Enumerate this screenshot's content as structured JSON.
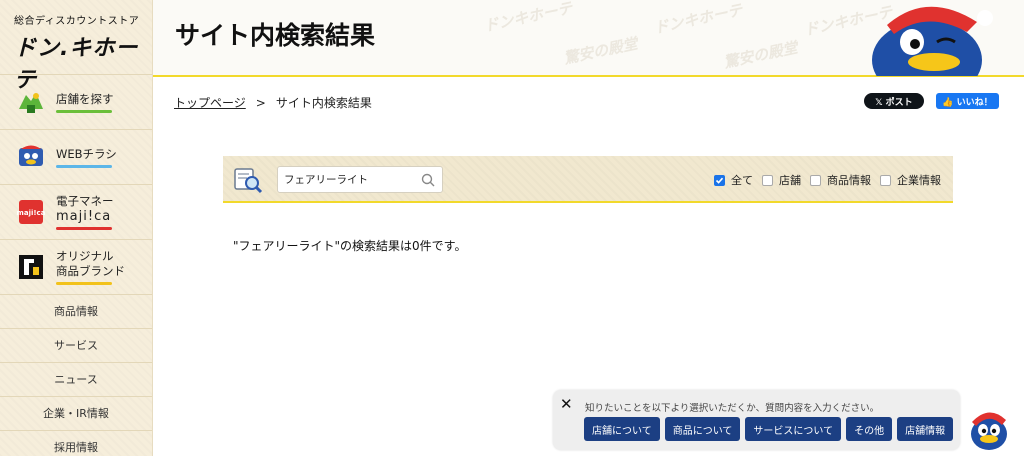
{
  "brand": {
    "tagline": "総合ディスカウントストア",
    "name": "ドン.キホーテ"
  },
  "sidebar": {
    "primary": [
      {
        "label": "店舗を探す",
        "accent": "#6bbf3a",
        "icon": "store-map-icon"
      },
      {
        "label": "WEBチラシ",
        "accent": "#5cb6e8",
        "icon": "mascot-flyer-icon"
      },
      {
        "label_line1": "電子マネー",
        "label_line2": "maji!ca",
        "accent": "#e0322f",
        "icon": "majica-card-icon"
      },
      {
        "label_line1": "オリジナル",
        "label_line2": "商品ブランド",
        "accent": "#f2c21b",
        "icon": "brand-logo-icon"
      }
    ],
    "secondary": [
      {
        "label": "商品情報"
      },
      {
        "label": "サービス"
      },
      {
        "label": "ニュース"
      },
      {
        "label": "企業・IR情報"
      },
      {
        "label": "採用情報"
      }
    ]
  },
  "header": {
    "title": "サイト内検索結果",
    "watermark": "ドンキホーテ",
    "watermark2": "驚安の殿堂"
  },
  "breadcrumb": {
    "home": "トップページ",
    "separator": ">",
    "current": "サイト内検索結果"
  },
  "share": {
    "x_label": "𝕏 ポスト",
    "fb_label": "👍 いいね！"
  },
  "search": {
    "value": "フェアリーライト",
    "filters": [
      {
        "label": "全て",
        "checked": true
      },
      {
        "label": "店舗",
        "checked": false
      },
      {
        "label": "商品情報",
        "checked": false
      },
      {
        "label": "企業情報",
        "checked": false
      }
    ]
  },
  "result": {
    "message": "\"フェアリーライト\"の検索結果は0件です。"
  },
  "chat": {
    "close": "✕",
    "prompt": "知りたいことを以下より選択いただくか、質問内容を入力ください。",
    "buttons": [
      "店舗について",
      "商品について",
      "サービスについて",
      "その他",
      "店舗情報"
    ]
  },
  "colors": {
    "accent_yellow": "#f2d92b",
    "chat_button": "#1c3f83",
    "sidebar_bg": "#f6eedb"
  }
}
